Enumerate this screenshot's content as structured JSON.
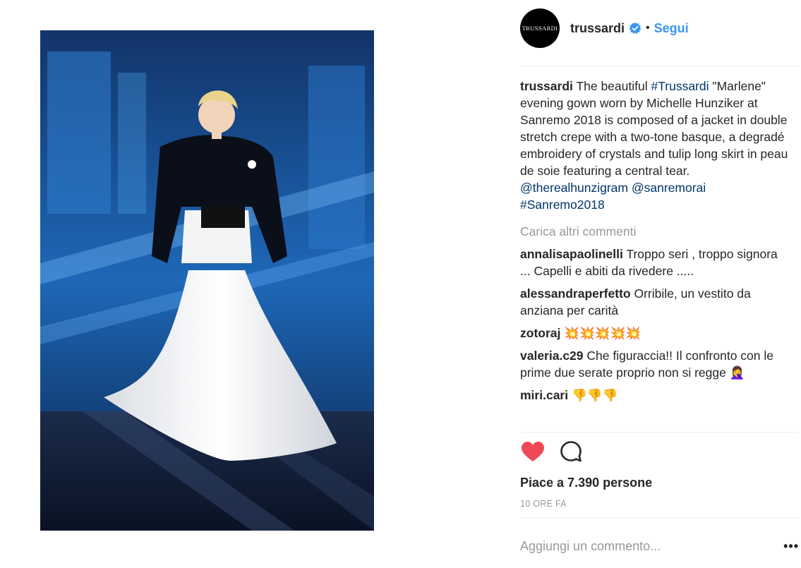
{
  "post": {
    "image_alt": "Michelle Hunziker in a Trussardi evening gown at Sanremo 2018",
    "author": {
      "username": "trussardi",
      "avatar_text": "TRUSSARDI",
      "verified": true,
      "follow_label": "Segui",
      "separator": "•"
    },
    "caption": {
      "username": "trussardi",
      "text_1": " The beautiful ",
      "tag_1": "#Trussardi",
      "text_2": " \"Marlene\" evening gown worn by Michelle Hunziker at Sanremo 2018 is composed of a jacket in double stretch crepe with a two-tone basque, a degradé embroidery of crystals and tulip long skirt in peau de soie featuring a central tear. ",
      "mention_1": "@therealhunzigram",
      "text_3": " ",
      "mention_2": "@sanremorai",
      "text_4": " ",
      "tag_2": "#Sanremo2018"
    },
    "load_more_label": "Carica altri commenti",
    "comments": [
      {
        "username": "annalisapaolinelli",
        "text": "Troppo seri , troppo signora ... Capelli e abiti da rivedere ....."
      },
      {
        "username": "alessandraperfetto",
        "text": "Orribile, un vestito da anziana per carità"
      },
      {
        "username": "zotoraj",
        "text": "💥💥💥💥💥"
      },
      {
        "username": "valeria.c29",
        "text": "Che figuraccia!! Il confronto con le prime due serate proprio non si regge 🤦‍♀️"
      },
      {
        "username": "miri.cari",
        "text": "👎👎👎"
      }
    ],
    "likes_label": "Piace a 7.390 persone",
    "time_label": "10 ORE FA",
    "add_comment_placeholder": "Aggiungi un commento...",
    "more_options_label": "•••"
  },
  "colors": {
    "accent": "#3897f0",
    "tag": "#003569",
    "like_heart": "#ed4956",
    "muted": "#999999"
  },
  "icons": {
    "like": "heart-icon",
    "comment": "comment-icon",
    "verified": "verified-badge-icon"
  }
}
